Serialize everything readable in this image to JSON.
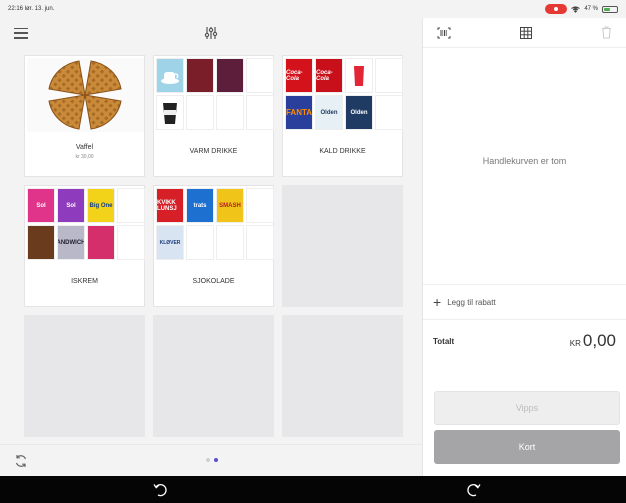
{
  "status_bar": {
    "time": "22:16",
    "date": "lør. 13. jun.",
    "battery": "47 %",
    "battery_level": 0.47
  },
  "products": {
    "tiles": [
      {
        "label": "Vaffel",
        "price": "kr 30,00"
      },
      {
        "label": "VARM DRIKKE"
      },
      {
        "label": "KALD DRIKKE"
      },
      {
        "label": "ISKREM"
      },
      {
        "label": "SJOKOLADE"
      }
    ],
    "thumb_text": {
      "cola_1": "Coca-Cola",
      "cola_2": "Coca-Cola",
      "fanta": "FANTA",
      "olden_1": "Olden",
      "olden_2": "Olden",
      "ice_1": "Sol",
      "ice_2": "Sol",
      "bigone": "Big One",
      "sandwich": "ANDWICH",
      "kvikk": "KVIKK LUNSJ",
      "troika": "trats",
      "smash": "SMASH",
      "klover": "KLØVER"
    }
  },
  "cart": {
    "empty_text": "Handlekurven er tom"
  },
  "discount": {
    "label": "Legg til rabatt"
  },
  "total": {
    "label": "Totalt",
    "currency": "KR",
    "amount": "0,00"
  },
  "buttons": {
    "vipps": "Vipps",
    "kort": "Kort"
  },
  "pagination": {
    "pages": 2,
    "current": 2
  }
}
